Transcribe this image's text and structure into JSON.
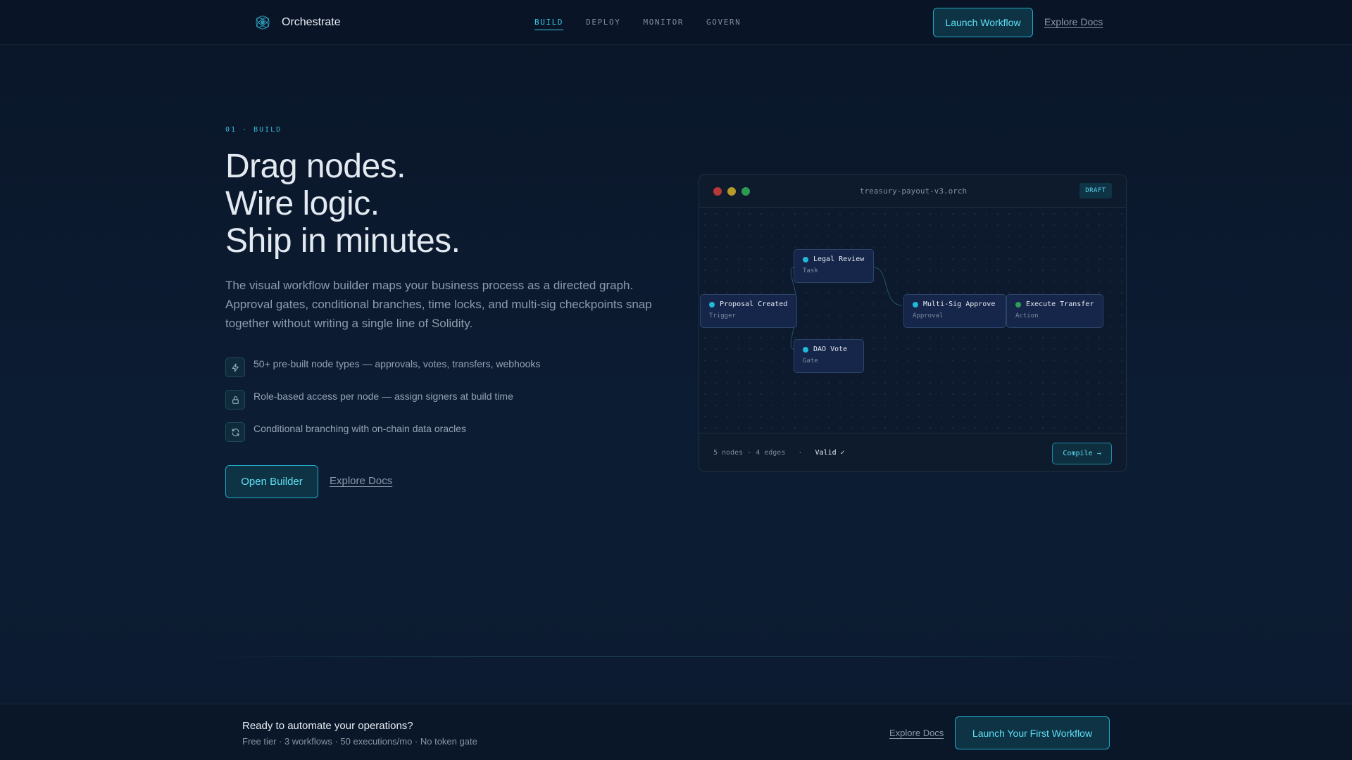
{
  "brand": {
    "name": "Orchestrate",
    "logo_icon": "orbit-logo-icon"
  },
  "nav": {
    "tabs": [
      {
        "label": "BUILD",
        "active": true
      },
      {
        "label": "DEPLOY",
        "active": false
      },
      {
        "label": "MONITOR",
        "active": false
      },
      {
        "label": "GOVERN",
        "active": false
      }
    ],
    "launch_label": "Launch Workflow",
    "docs_label": "Explore Docs"
  },
  "hero": {
    "eyebrow": "01 · BUILD",
    "headline": [
      "Drag nodes.",
      "Wire logic.",
      "Ship in minutes."
    ],
    "lede": "The visual workflow builder maps your business process as a directed graph. Approval gates, conditional branches, time locks, and multi-sig checkpoints snap together without writing a single line of Solidity.",
    "features": [
      {
        "icon": "lightning-icon",
        "text": "50+ pre-built node types — approvals, votes, transfers, webhooks"
      },
      {
        "icon": "lock-icon",
        "text": "Role-based access per node — assign signers at build time"
      },
      {
        "icon": "refresh-icon",
        "text": "Conditional branching with on-chain data oracles"
      }
    ],
    "primary_button": "Open Builder",
    "secondary_link": "Explore Docs"
  },
  "editor": {
    "filename": "treasury-payout-v3.orch",
    "badge": "DRAFT",
    "nodes": [
      {
        "title": "Legal Review",
        "type": "Task"
      },
      {
        "title": "Proposal Created",
        "type": "Trigger"
      },
      {
        "title": "Multi-Sig Approve",
        "type": "Approval"
      },
      {
        "title": "Execute Transfer",
        "type": "Action"
      },
      {
        "title": "DAO Vote",
        "type": "Gate"
      }
    ],
    "stats": "5 nodes · 4 edges",
    "separator": "·",
    "status": "Valid ✓",
    "compile_label": "Compile →"
  },
  "footer": {
    "title": "Ready to automate your operations?",
    "subtitle": "Free tier · 3 workflows · 50 executions/mo · No token gate",
    "docs_label": "Explore Docs",
    "cta_label": "Launch Your First Workflow"
  },
  "colors": {
    "accent": "#38c6e6",
    "background": "#0a1628",
    "dot_red": "#c0392b",
    "dot_yellow": "#c9a227",
    "dot_green": "#27ae60",
    "node_cyan": "#22b8d8",
    "node_green": "#2e9d57"
  }
}
